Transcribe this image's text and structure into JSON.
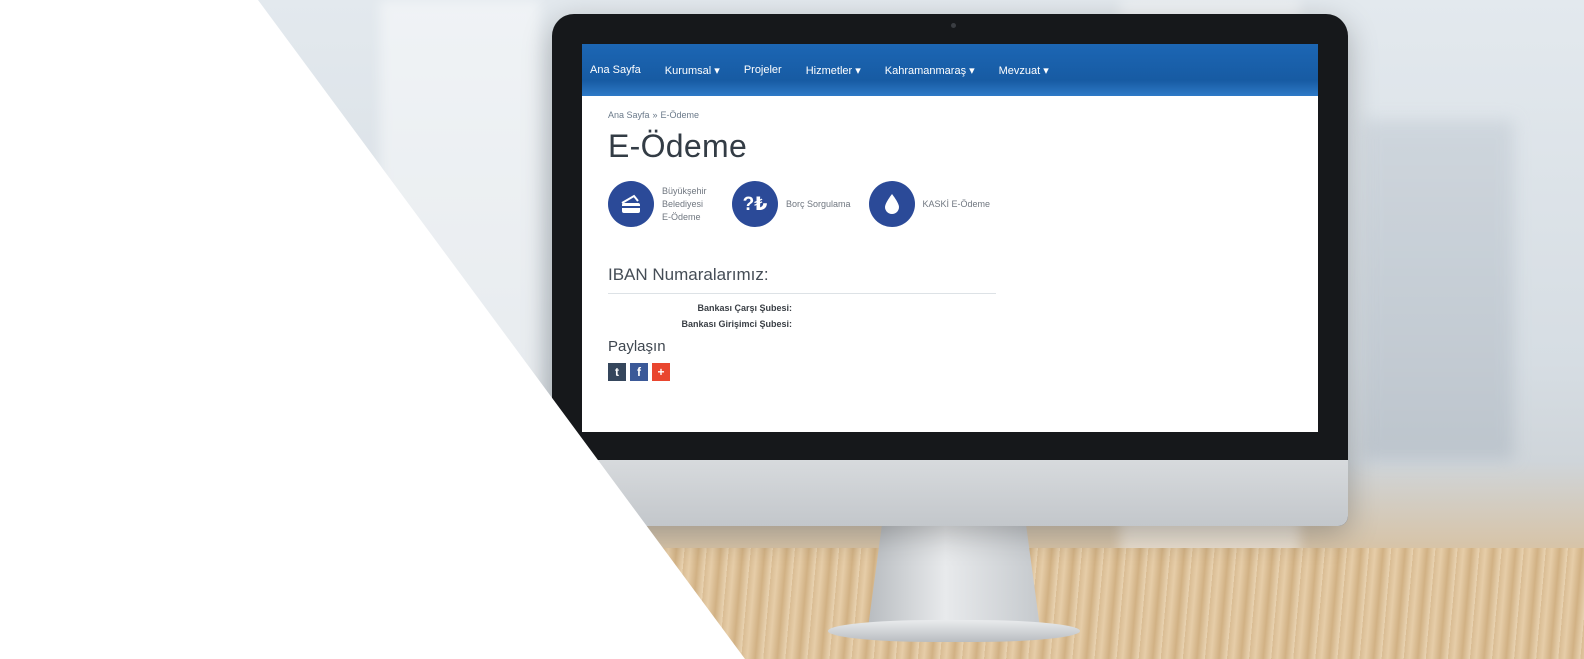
{
  "nav": {
    "items": [
      {
        "label": "Ana Sayfa"
      },
      {
        "label": "Kurumsal ▾"
      },
      {
        "label": "Projeler"
      },
      {
        "label": "Hizmetler ▾"
      },
      {
        "label": "Kahramanmaraş ▾"
      },
      {
        "label": "Mevzuat ▾"
      }
    ]
  },
  "breadcrumb": {
    "home": "Ana Sayfa",
    "separator": "»",
    "current": "E-Ödeme"
  },
  "page_title": "E-Ödeme",
  "payments": [
    {
      "icon": "card-payment-icon",
      "label_lines": [
        "Büyükşehir",
        "Belediyesi",
        "E-Ödeme"
      ]
    },
    {
      "icon": "question-lira-icon",
      "icon_text": "?₺",
      "label": "Borç Sorgulama"
    },
    {
      "icon": "water-drop-icon",
      "label": "KASKİ E-Ödeme"
    }
  ],
  "iban": {
    "title": "IBAN Numaralarımız:",
    "rows": [
      "Bankası Çarşı Şubesi:",
      "Bankası Girişimci Şubesi:"
    ]
  },
  "share": {
    "title": "Paylaşın",
    "buttons": [
      {
        "icon": "tumblr-icon",
        "glyph": "t"
      },
      {
        "icon": "facebook-icon",
        "glyph": "f"
      },
      {
        "icon": "plus-share-icon",
        "glyph": "+"
      }
    ]
  },
  "colors": {
    "nav": "#1c66b4",
    "icon_circle": "#2b4a98",
    "tumblr": "#35465c",
    "facebook": "#3b5998",
    "share_plus": "#e9462f"
  }
}
